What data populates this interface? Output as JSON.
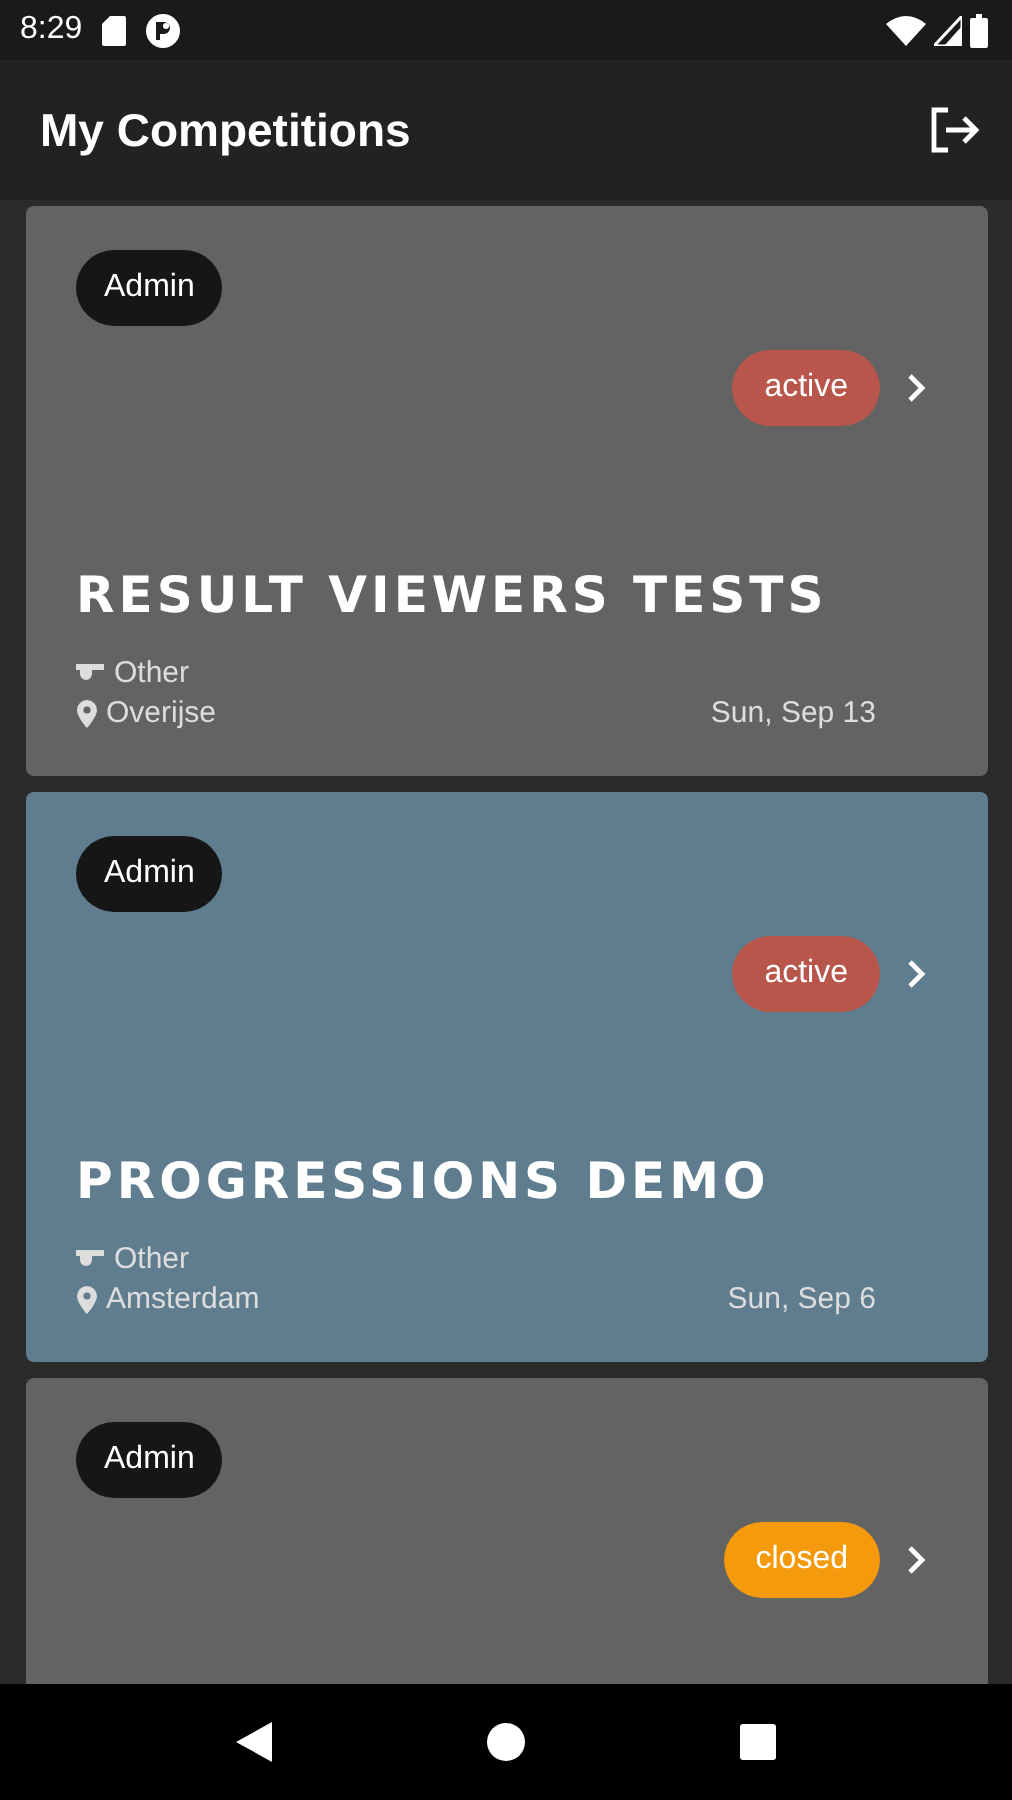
{
  "status_bar": {
    "time": "8:29"
  },
  "app_bar": {
    "title": "My Competitions"
  },
  "competitions": [
    {
      "role": "Admin",
      "status": {
        "label": "active",
        "color": "#b8564b"
      },
      "color": "#636363",
      "title": "RESULT VIEWERS TESTS",
      "category": "Other",
      "location": "Overijse",
      "date": "Sun, Sep 13"
    },
    {
      "role": "Admin",
      "status": {
        "label": "active",
        "color": "#b8564b"
      },
      "color": "#5f7d8e",
      "title": "PROGRESSIONS DEMO",
      "category": "Other",
      "location": "Amsterdam",
      "date": "Sun, Sep 6"
    },
    {
      "role": "Admin",
      "status": {
        "label": "closed",
        "color": "#f49a0c"
      },
      "color": "#636363"
    }
  ]
}
